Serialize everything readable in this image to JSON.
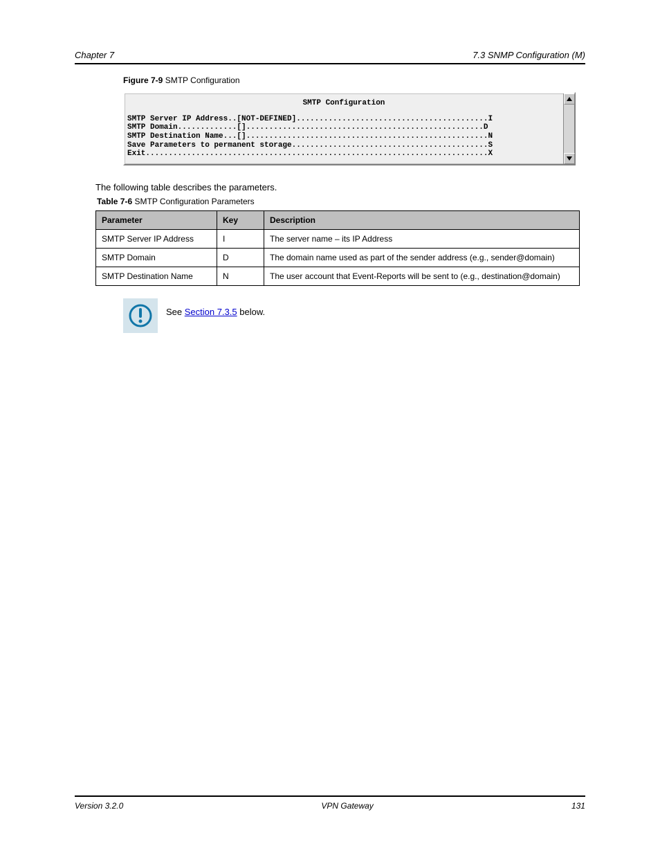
{
  "header": {
    "chapter": "Chapter 7",
    "section": "7.3 SNMP Configuration (M)"
  },
  "figure": {
    "label": "Figure 7-9",
    "title": "SMTP Configuration"
  },
  "terminal": {
    "title": "SMTP Configuration",
    "lines": [
      "SMTP Server IP Address..[NOT-DEFINED]..........................................I",
      "SMTP Domain.............[]....................................................D",
      "SMTP Destination Name...[].....................................................N",
      "",
      "Save Parameters to permanent storage...........................................S",
      "Exit...........................................................................X"
    ]
  },
  "params_intro": "The following table describes the parameters.",
  "table_caption": {
    "label": "Table 7-6",
    "title": "SMTP Configuration Parameters"
  },
  "table": {
    "headers": [
      "Parameter",
      "Key",
      "Description"
    ],
    "rows": [
      {
        "param": "SMTP Server IP Address",
        "key": "I",
        "desc": "The server name – its IP Address"
      },
      {
        "param": "SMTP Domain",
        "key": "D",
        "desc": "The domain name used as part of the sender address (e.g., sender@domain)"
      },
      {
        "param": "SMTP Destination Name",
        "key": "N",
        "desc": "The user account that Event-Reports will be sent to (e.g., destination@domain)"
      }
    ]
  },
  "note": {
    "prefix": "See ",
    "link": "Section 7.3.5",
    "suffix": " below."
  },
  "footer": {
    "left": "Version 3.2.0",
    "center": "VPN Gateway",
    "right": "131"
  }
}
